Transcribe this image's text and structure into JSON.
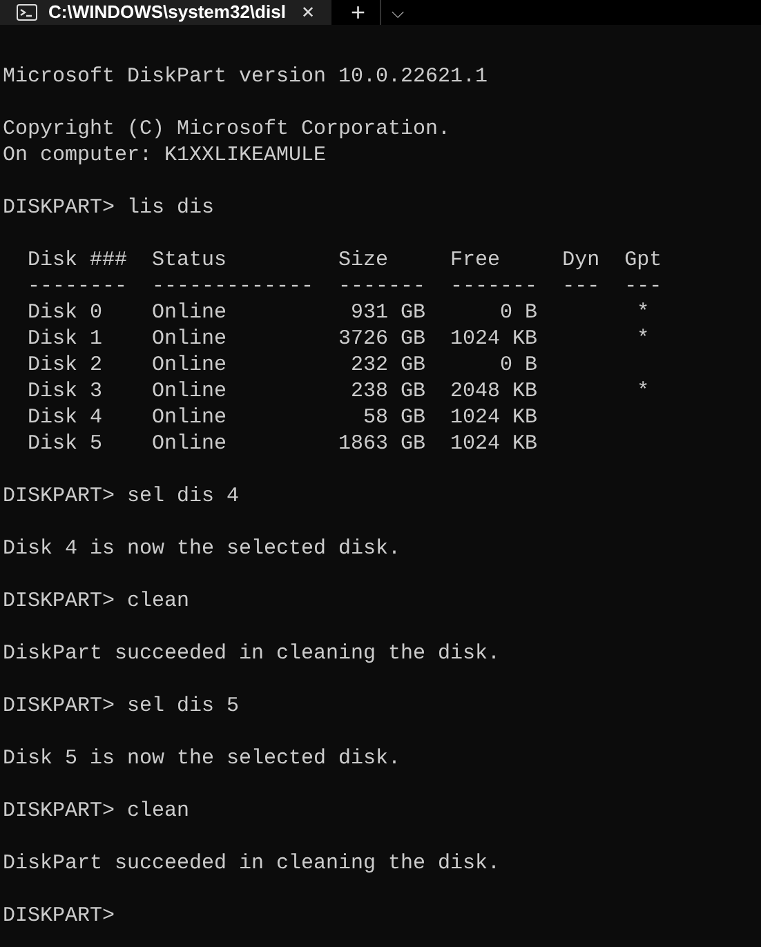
{
  "tab": {
    "title": "C:\\WINDOWS\\system32\\disl",
    "close": "✕",
    "selected": true
  },
  "new_tab": "+",
  "dropdown": "⌵",
  "blocks": [
    [
      "Microsoft DiskPart version 10.0.22621.1"
    ],
    [
      "Copyright (C) Microsoft Corporation.",
      "On computer: K1XXLIKEAMULE"
    ],
    [
      "DISKPART> lis dis"
    ],
    [
      "  Disk ###  Status         Size     Free     Dyn  Gpt",
      "  --------  -------------  -------  -------  ---  ---",
      "  Disk 0    Online          931 GB      0 B        *",
      "  Disk 1    Online         3726 GB  1024 KB        *",
      "  Disk 2    Online          232 GB      0 B",
      "  Disk 3    Online          238 GB  2048 KB        *",
      "  Disk 4    Online           58 GB  1024 KB",
      "  Disk 5    Online         1863 GB  1024 KB"
    ],
    [
      "DISKPART> sel dis 4"
    ],
    [
      "Disk 4 is now the selected disk."
    ],
    [
      "DISKPART> clean"
    ],
    [
      "DiskPart succeeded in cleaning the disk."
    ],
    [
      "DISKPART> sel dis 5"
    ],
    [
      "Disk 5 is now the selected disk."
    ],
    [
      "DISKPART> clean"
    ],
    [
      "DiskPart succeeded in cleaning the disk."
    ],
    [
      "DISKPART>"
    ]
  ]
}
